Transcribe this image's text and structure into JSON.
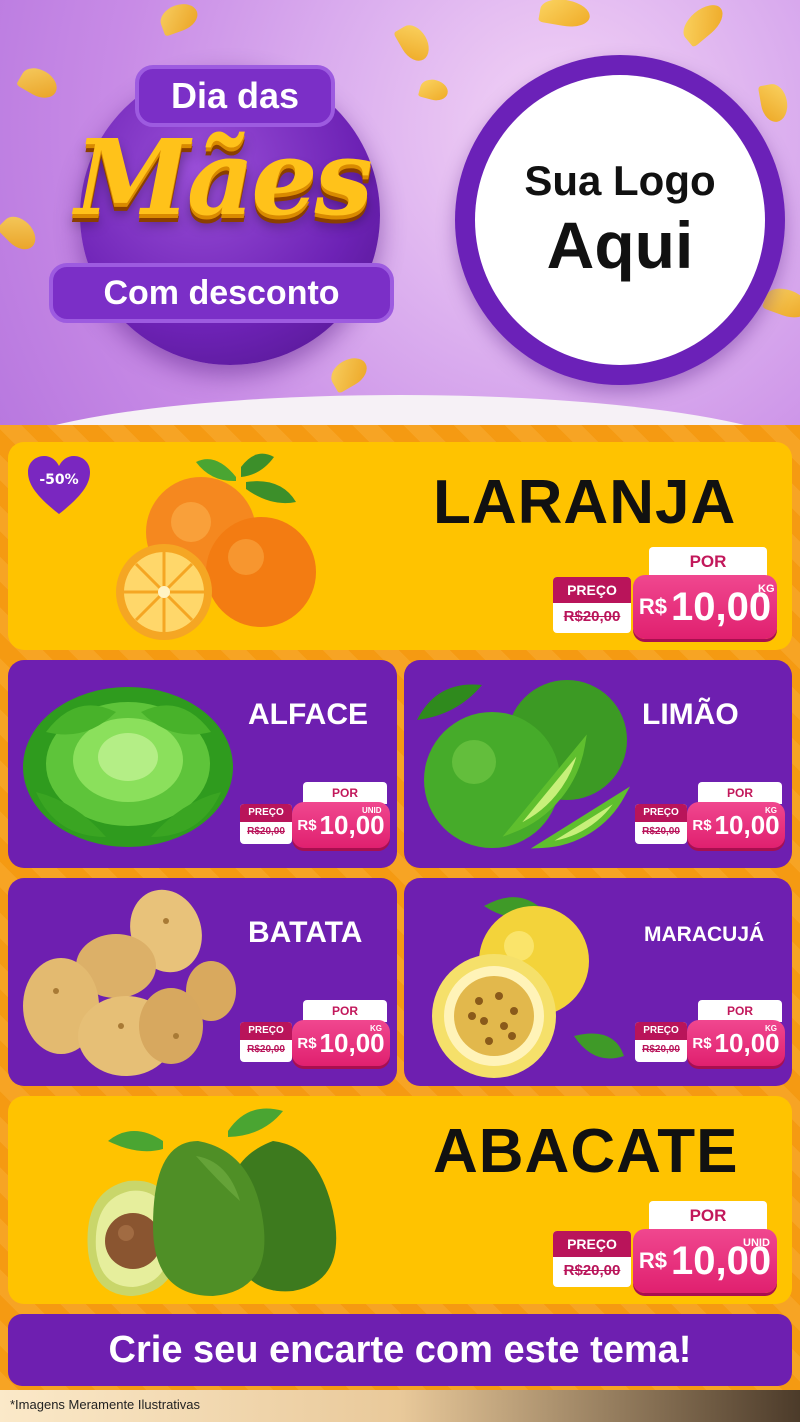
{
  "header": {
    "badge_top": "Dia das",
    "badge_main": "Mães",
    "badge_bottom": "Com desconto",
    "logo_line1": "Sua Logo",
    "logo_line2": "Aqui"
  },
  "discount_badge": "-50%",
  "products": [
    {
      "name": "LARANJA",
      "por": "POR",
      "preco_label": "PREÇO",
      "old_price": "R$20,00",
      "currency": "R$",
      "price": "10,00",
      "unit": "KG",
      "image": "orange-icon"
    },
    {
      "name": "ALFACE",
      "por": "POR",
      "preco_label": "PREÇO",
      "old_price": "R$20,00",
      "currency": "R$",
      "price": "10,00",
      "unit": "UNID",
      "image": "lettuce-icon"
    },
    {
      "name": "LIMÃO",
      "por": "POR",
      "preco_label": "PREÇO",
      "old_price": "R$20,00",
      "currency": "R$",
      "price": "10,00",
      "unit": "KG",
      "image": "lime-icon"
    },
    {
      "name": "BATATA",
      "por": "POR",
      "preco_label": "PREÇO",
      "old_price": "R$20,00",
      "currency": "R$",
      "price": "10,00",
      "unit": "KG",
      "image": "potato-icon"
    },
    {
      "name": "MARACUJÁ",
      "por": "POR",
      "preco_label": "PREÇO",
      "old_price": "R$20,00",
      "currency": "R$",
      "price": "10,00",
      "unit": "KG",
      "image": "passion-fruit-icon"
    },
    {
      "name": "ABACATE",
      "por": "POR",
      "preco_label": "PREÇO",
      "old_price": "R$20,00",
      "currency": "R$",
      "price": "10,00",
      "unit": "UNID",
      "image": "avocado-icon"
    }
  ],
  "cta": "Crie seu encarte com este tema!",
  "footer_note": "*Imagens Meramente Ilustrativas",
  "colors": {
    "purple": "#6e1fb0",
    "yellow": "#ffc300",
    "orange": "#f59a12",
    "pink": "#e0206f"
  }
}
